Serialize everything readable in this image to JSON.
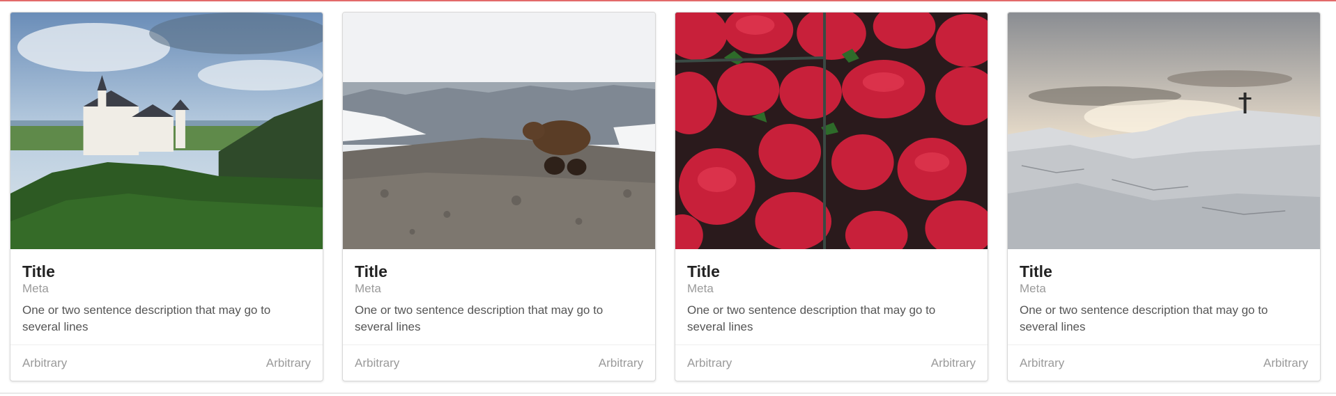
{
  "cards": [
    {
      "image_alt": "castle-photo",
      "title": "Title",
      "meta": "Meta",
      "description": "One or two sentence description that may go to several lines",
      "extra_left": "Arbitrary",
      "extra_right": "Arbitrary"
    },
    {
      "image_alt": "bear-photo",
      "title": "Title",
      "meta": "Meta",
      "description": "One or two sentence description that may go to several lines",
      "extra_left": "Arbitrary",
      "extra_right": "Arbitrary"
    },
    {
      "image_alt": "strawberries-photo",
      "title": "Title",
      "meta": "Meta",
      "description": "One or two sentence description that may go to several lines",
      "extra_left": "Arbitrary",
      "extra_right": "Arbitrary"
    },
    {
      "image_alt": "mountain-cross-photo",
      "title": "Title",
      "meta": "Meta",
      "description": "One or two sentence description that may go to several lines",
      "extra_left": "Arbitrary",
      "extra_right": "Arbitrary"
    }
  ],
  "colors": {
    "accent_line": "#e26a6a",
    "title": "#222222",
    "meta": "#9a9a9a",
    "text": "#555555"
  }
}
